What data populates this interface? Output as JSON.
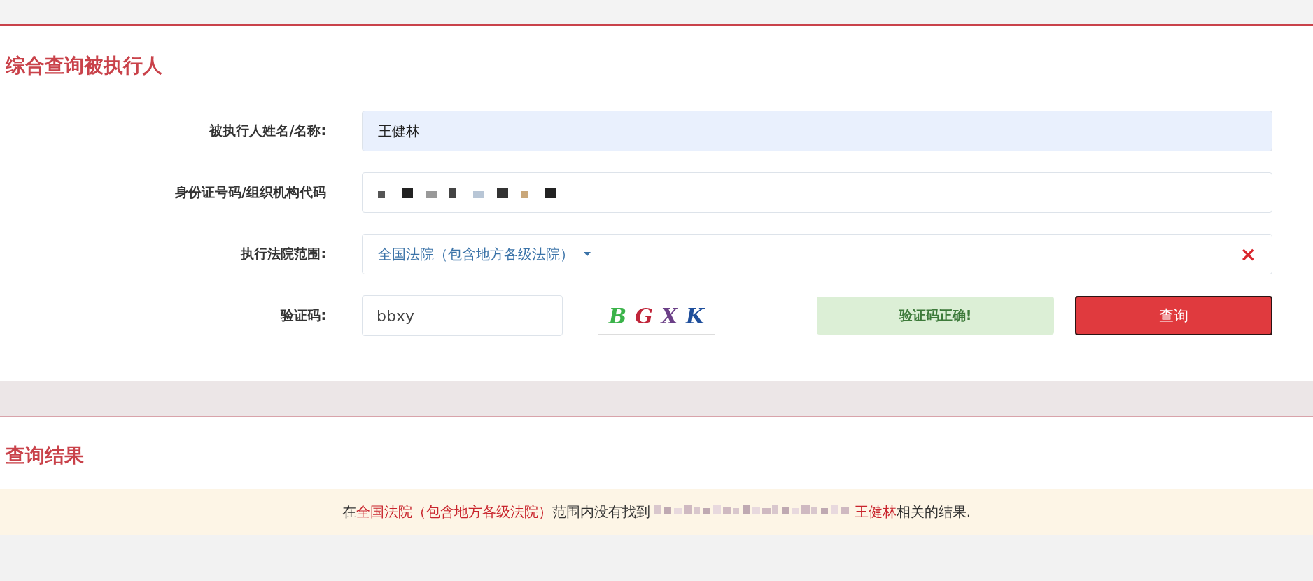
{
  "title": "综合查询被执行人",
  "form": {
    "rows": [
      {
        "kind": "text",
        "label": "被执行人姓名/名称:",
        "value": "王健林",
        "highlighted": true
      },
      {
        "kind": "redacted",
        "label": "身份证号码/组织机构代码",
        "highlighted": false
      },
      {
        "kind": "select",
        "label": "执行法院范围:",
        "value": "全国法院（包含地方各级法院）",
        "clear": "×"
      },
      {
        "kind": "captcha",
        "label": "验证码:",
        "value": "bbxy",
        "captcha_chars": [
          {
            "char": "B",
            "color": "#3bb34a"
          },
          {
            "char": "G",
            "color": "#c0253a"
          },
          {
            "char": "X",
            "color": "#6b3f87"
          },
          {
            "char": "K",
            "color": "#1f4f9c"
          }
        ],
        "status": "验证码正确!",
        "button": "查询"
      }
    ]
  },
  "results": {
    "title": "查询结果",
    "message": [
      {
        "kind": "plain",
        "text": "在"
      },
      {
        "kind": "highlight",
        "text": "全国法院（包含地方各级法院）"
      },
      {
        "kind": "plain",
        "text": "范围内没有找到"
      },
      {
        "kind": "redacted"
      },
      {
        "kind": "highlight",
        "text": "王健林"
      },
      {
        "kind": "plain",
        "text": "相关的结果."
      }
    ]
  }
}
